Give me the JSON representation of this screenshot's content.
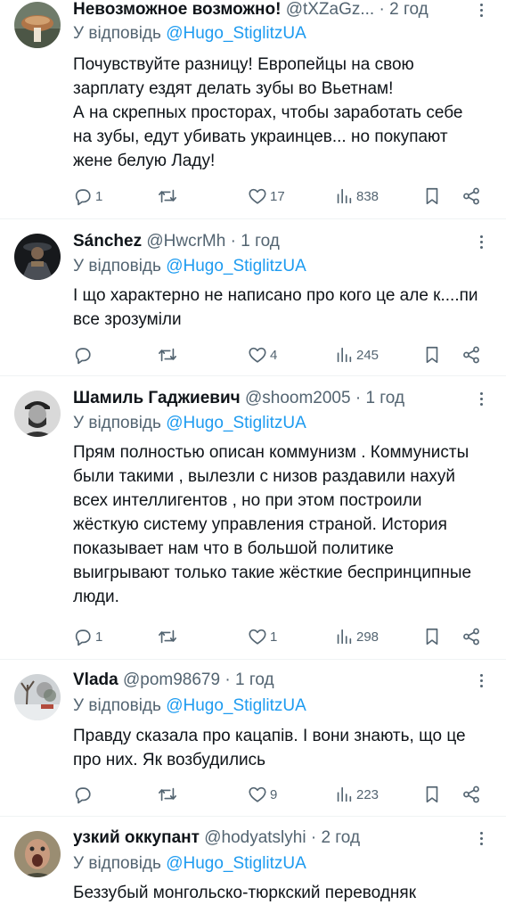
{
  "tweets": [
    {
      "name": "Невозможное возможно!",
      "handle": "@tXZaGz...",
      "sep": "·",
      "time": "2 год",
      "reply_prefix": "У відповідь ",
      "reply_to": "@Hugo_StiglitzUA",
      "text": "Почувствуйте разницу! Европейцы на свою зарплату ездят делать зубы во Вьетнам!\nА на скрепных просторах,  чтобы заработать себе на зубы,  едут убивать украинцев... но покупают жене белую Ладу!",
      "replies": "1",
      "retweets": "",
      "likes": "17",
      "views": "838"
    },
    {
      "name": "Sánchez",
      "handle": "@HwcrMh",
      "sep": "·",
      "time": "1 год",
      "reply_prefix": "У відповідь ",
      "reply_to": "@Hugo_StiglitzUA",
      "text": "І що характерно не написано про кого це але к....пи все зрозуміли",
      "replies": "",
      "retweets": "",
      "likes": "4",
      "views": "245"
    },
    {
      "name": "Шамиль Гаджиевич",
      "handle": "@shoom2005",
      "sep": "·",
      "time": "1 год",
      "reply_prefix": "У відповідь ",
      "reply_to": "@Hugo_StiglitzUA",
      "text": "Прям полностью описан коммунизм . Коммунисты были такими , вылезли с низов раздавили нахуй всех интеллигентов , но при этом построили жёсткую систему управления страной. История показывает нам что в большой политике выигрывают только такие жёсткие беспринципные люди.",
      "replies": "1",
      "retweets": "",
      "likes": "1",
      "views": "298"
    },
    {
      "name": "Vlada",
      "handle": "@pom98679",
      "sep": "·",
      "time": "1 год",
      "reply_prefix": "У відповідь ",
      "reply_to": "@Hugo_StiglitzUA",
      "text": "Правду сказала про кацапів. І вони знають, що це про них. Як возбудились",
      "replies": "",
      "retweets": "",
      "likes": "9",
      "views": "223"
    },
    {
      "name": "узкий оккупант",
      "handle": "@hodyatslyhi",
      "sep": "·",
      "time": "2 год",
      "reply_prefix": "У відповідь ",
      "reply_to": "@Hugo_StiglitzUA",
      "text": "Беззубый монгольско-тюркский переводняк",
      "replies": "",
      "retweets": "",
      "likes": "",
      "views": ""
    }
  ],
  "colors": {
    "text": "#0f1419",
    "muted": "#536471",
    "link": "#1d9bf0",
    "divider": "#eff3f4"
  },
  "icons": [
    "reply-icon",
    "retweet-icon",
    "like-icon",
    "views-icon",
    "bookmark-icon",
    "share-icon",
    "more-icon"
  ]
}
